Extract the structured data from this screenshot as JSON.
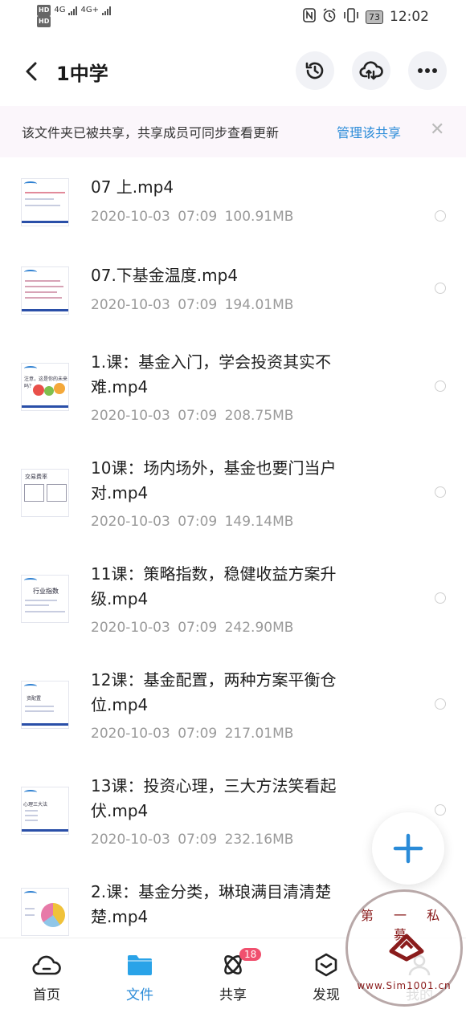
{
  "status_bar": {
    "hd_top": "HD",
    "hd_bottom": "HD",
    "net1": "4G",
    "net2": "4G+",
    "battery": "73",
    "time": "12:02"
  },
  "header": {
    "title": "1中学"
  },
  "banner": {
    "text": "该文件夹已被共享，共享成员可同步查看更新",
    "link": "管理该共享",
    "close": "✕"
  },
  "files": [
    {
      "name": "07  上.mp4",
      "date": "2020-10-03",
      "time": "07:09",
      "size": "100.91MB"
    },
    {
      "name": "07.下基金温度.mp4",
      "date": "2020-10-03",
      "time": "07:09",
      "size": "194.01MB"
    },
    {
      "name": "1.课：基金入门，学会投资其实不难.mp4",
      "date": "2020-10-03",
      "time": "07:09",
      "size": "208.75MB"
    },
    {
      "name": "10课：场内场外，基金也要门当户对.mp4",
      "date": "2020-10-03",
      "time": "07:09",
      "size": "149.14MB"
    },
    {
      "name": "11课：策略指数，稳健收益方案升级.mp4",
      "date": "2020-10-03",
      "time": "07:09",
      "size": "242.90MB"
    },
    {
      "name": "12课：基金配置，两种方案平衡仓位.mp4",
      "date": "2020-10-03",
      "time": "07:09",
      "size": "217.01MB"
    },
    {
      "name": "13课：投资心理，三大方法笑看起伏.mp4",
      "date": "2020-10-03",
      "time": "07:09",
      "size": "232.16MB"
    },
    {
      "name": "2.课：基金分类，琳琅满目清清楚楚.mp4",
      "date": "",
      "time": "",
      "size": ""
    }
  ],
  "thumb_text": {
    "t3": "注意，这是你的未来吗？",
    "t4": "交易费率",
    "t5": "行业指数",
    "t6": "资配置",
    "t7": "心理三大法"
  },
  "bottom_nav": {
    "home": "首页",
    "files": "文件",
    "share": "共享",
    "share_badge": "18",
    "discover": "发现",
    "mine": "我的"
  },
  "watermark": {
    "top": "第 一 私 募",
    "bottom": "www.Sim1001.cn"
  },
  "colors": {
    "accent": "#2a8bd8",
    "badge": "#f0506e",
    "banner_bg": "#fbf6fb"
  }
}
